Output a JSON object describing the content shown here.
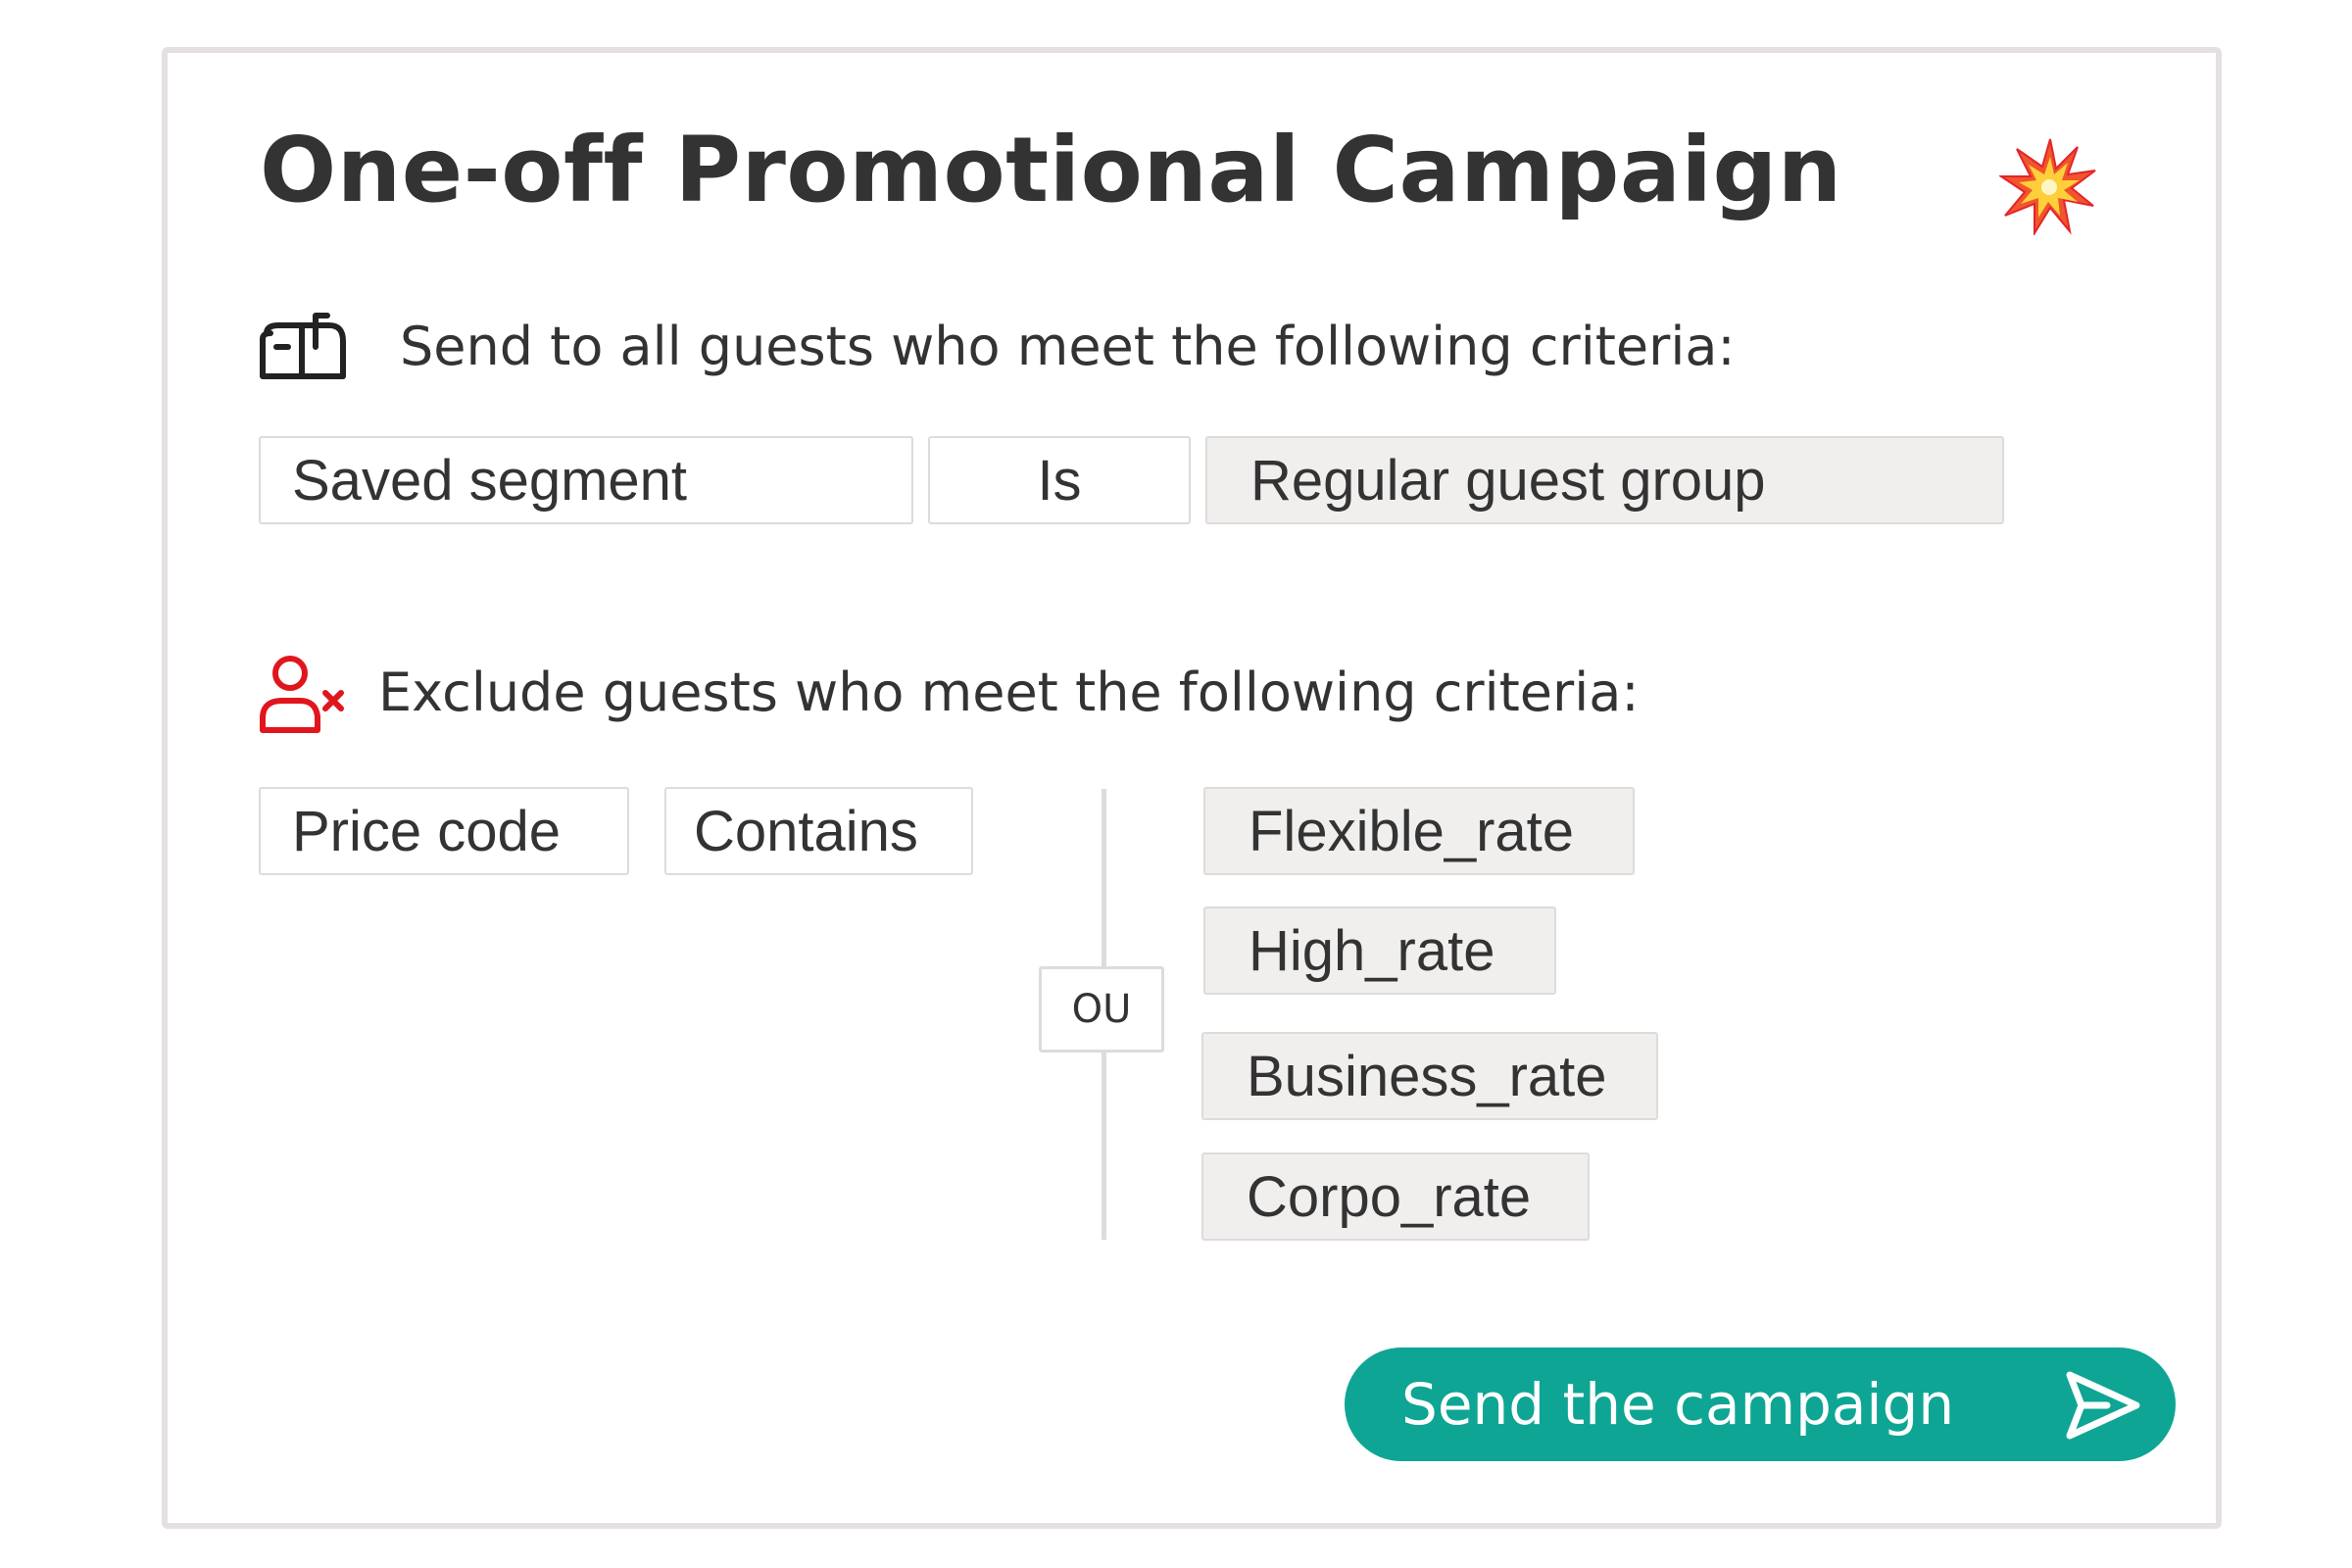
{
  "campaign": {
    "title": "One-off Promotional Campaign",
    "title_icon": "collision-burst-icon"
  },
  "include_section": {
    "icon": "mailbox-icon",
    "heading": "Send to all guests who meet the following criteria:",
    "criteria": {
      "field": "Saved segment",
      "operator": "Is",
      "value": "Regular guest group"
    }
  },
  "exclude_section": {
    "icon": "user-x-icon",
    "icon_color": "#e0161c",
    "heading": "Exclude guests who meet the following criteria:",
    "criteria": {
      "field": "Price code",
      "operator": "Contains",
      "connector": "OU",
      "values": [
        "Flexible_rate",
        "High_rate",
        "Business_rate",
        "Corpo_rate"
      ]
    }
  },
  "actions": {
    "send_label": "Send the campaign",
    "send_icon": "send-icon",
    "send_color": "#0ea594"
  }
}
